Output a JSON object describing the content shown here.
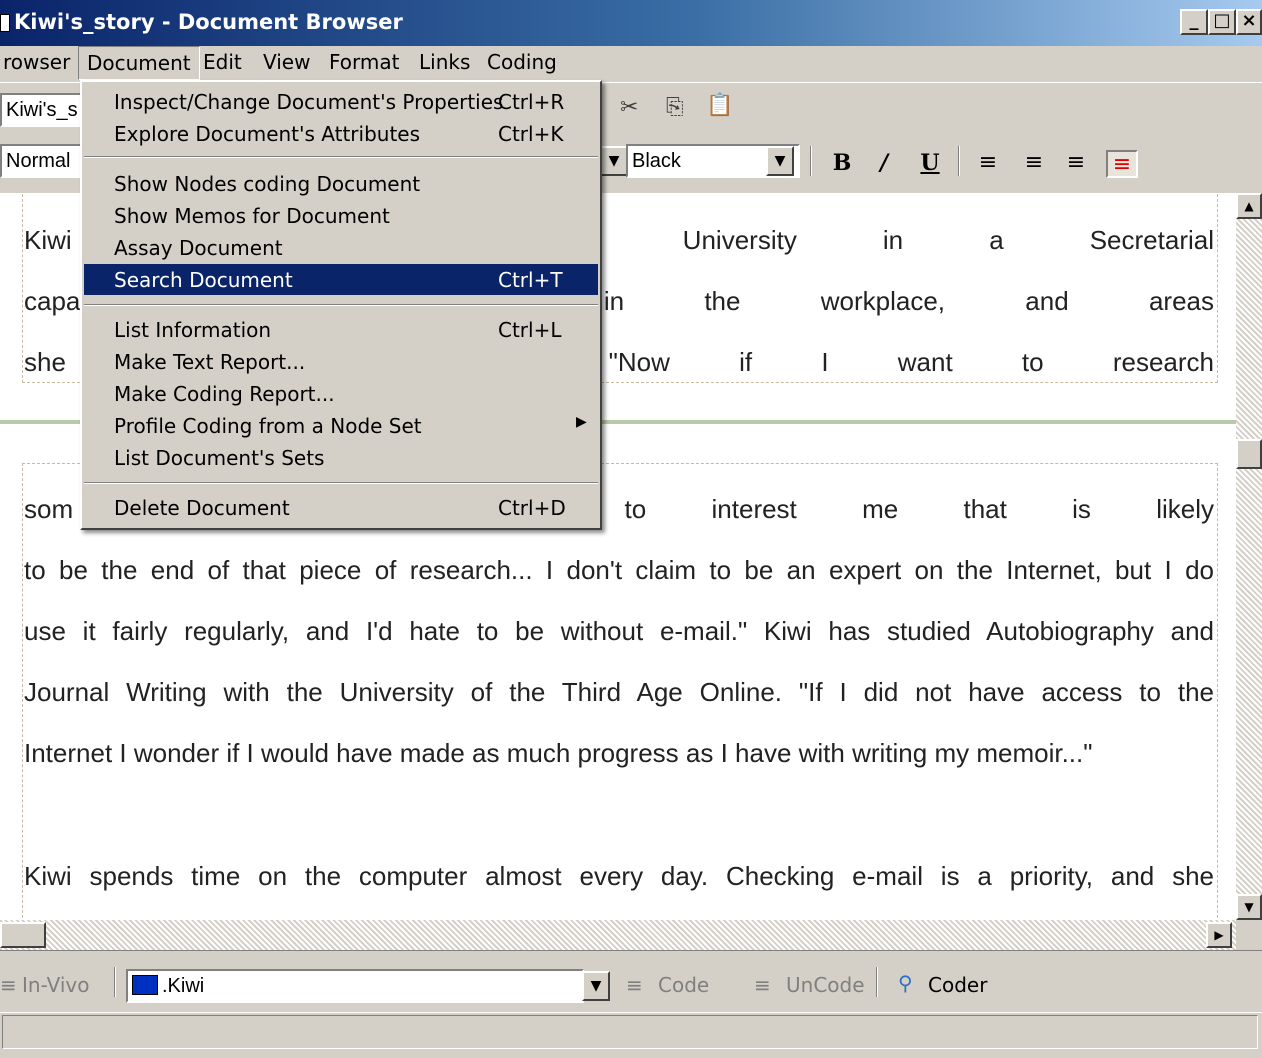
{
  "window": {
    "title": "Kiwi's_story - Document Browser"
  },
  "menubar": {
    "items": [
      "rowser",
      "Document",
      "Edit",
      "View",
      "Format",
      "Links",
      "Coding"
    ]
  },
  "toolbar": {
    "document_combo": "Kiwi's_s",
    "style_combo": "Normal",
    "color_combo": "Black",
    "bold": "B",
    "italic": "/",
    "underline": "U"
  },
  "document_menu": {
    "items": [
      {
        "label": "Inspect/Change Document's Properties",
        "shortcut": "Ctrl+R"
      },
      {
        "label": "Explore Document's Attributes",
        "shortcut": "Ctrl+K"
      },
      {
        "label": "Show Nodes coding Document",
        "shortcut": ""
      },
      {
        "label": "Show Memos for Document",
        "shortcut": ""
      },
      {
        "label": "Assay Document",
        "shortcut": ""
      },
      {
        "label": "Search Document",
        "shortcut": "Ctrl+T"
      },
      {
        "label": "List Information",
        "shortcut": "Ctrl+L"
      },
      {
        "label": "Make Text Report...",
        "shortcut": ""
      },
      {
        "label": "Make Coding Report...",
        "shortcut": ""
      },
      {
        "label": "Profile Coding from a Node Set",
        "shortcut": ""
      },
      {
        "label": "List Document's Sets",
        "shortcut": ""
      },
      {
        "label": "Delete Document",
        "shortcut": "Ctrl+D"
      }
    ],
    "highlighted": "Search Document"
  },
  "document": {
    "para1": [
      "Kiwi in a New Zealand University in a Secretarial",
      "capa she has performed in the workplace, and areas",
      "she at a personal level. \"Now if I want to research"
    ],
    "para2": [
      "som sequently, if it ceases to interest me that is likely",
      "to be the end of that piece of research... I don't claim to be an expert on the Internet, but I do",
      "use it fairly regularly, and I'd hate to be without e-mail.\"  Kiwi has studied Autobiography and",
      "Journal Writing with the University of the Third Age Online. \"If I did not have access to the",
      "Internet I wonder if I would have made as much progress as I have with writing my memoir...\""
    ],
    "para3": "Kiwi spends time on the computer almost every day. Checking e-mail is a priority, and she"
  },
  "coding_bar": {
    "in_vivo": "In-Vivo",
    "node": ".Kiwi",
    "code": "Code",
    "uncode": "UnCode",
    "coder": "Coder"
  }
}
